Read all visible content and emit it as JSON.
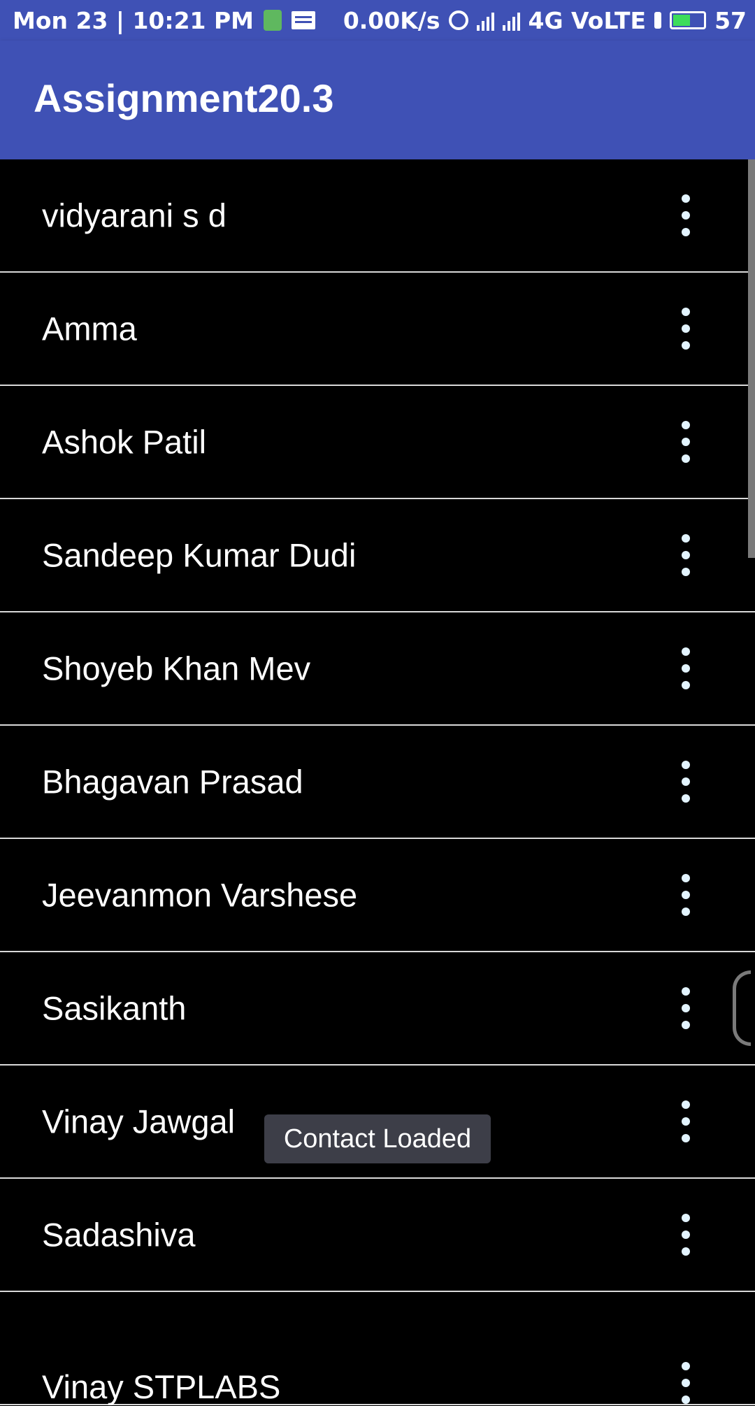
{
  "status_bar": {
    "datetime": "Mon 23 | 10:21 PM",
    "net_speed": "0.00K/s",
    "network": "4G VoLTE",
    "battery": "57",
    "battery_level_percent": 57,
    "accent": "#3f51b5"
  },
  "app": {
    "title": "Assignment20.3"
  },
  "contacts": [
    {
      "name": "vidyarani s d"
    },
    {
      "name": "Amma"
    },
    {
      "name": "Ashok Patil"
    },
    {
      "name": "Sandeep Kumar Dudi"
    },
    {
      "name": "Shoyeb Khan Mev"
    },
    {
      "name": "Bhagavan Prasad"
    },
    {
      "name": "Jeevanmon Varshese"
    },
    {
      "name": "Sasikanth"
    },
    {
      "name": "Vinay Jawgal"
    },
    {
      "name": "Sadashiva"
    },
    {
      "name": "Vinay STPLABS"
    }
  ],
  "toast": {
    "message": "Contact Loaded"
  },
  "icons": {
    "row_menu": "more-vert-icon",
    "alarm": "alarm-icon",
    "message": "message-icon",
    "battery": "battery-icon"
  }
}
